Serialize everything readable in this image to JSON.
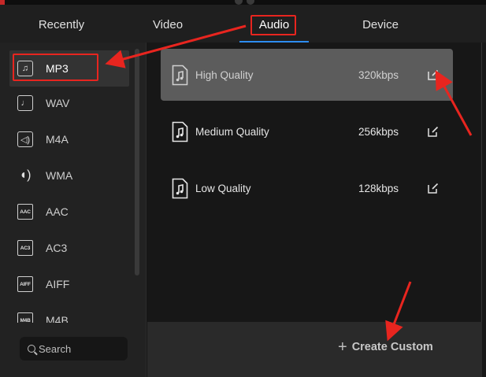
{
  "tabs": [
    {
      "label": "Recently"
    },
    {
      "label": "Video"
    },
    {
      "label": "Audio"
    },
    {
      "label": "Device"
    }
  ],
  "active_tab": "Audio",
  "formats": [
    {
      "label": "MP3",
      "icon": "music-note-icon",
      "selected": true
    },
    {
      "label": "WAV",
      "icon": "music-note-icon"
    },
    {
      "label": "M4A",
      "icon": "speaker-icon"
    },
    {
      "label": "WMA",
      "icon": "speaker-round-icon"
    },
    {
      "label": "AAC",
      "icon": "aac-file-icon",
      "tag": "AAC"
    },
    {
      "label": "AC3",
      "icon": "ac3-file-icon",
      "tag": "AC3"
    },
    {
      "label": "AIFF",
      "icon": "aiff-file-icon",
      "tag": "AIFF"
    },
    {
      "label": "M4B",
      "icon": "m4b-file-icon",
      "tag": "M4B"
    }
  ],
  "search": {
    "placeholder": "Search"
  },
  "presets": [
    {
      "name": "High Quality",
      "bitrate": "320kbps",
      "selected": true
    },
    {
      "name": "Medium Quality",
      "bitrate": "256kbps"
    },
    {
      "name": "Low Quality",
      "bitrate": "128kbps"
    }
  ],
  "create_custom": {
    "label": "Create Custom"
  },
  "colors": {
    "annotation_red": "#e8251f",
    "accent_blue": "#2d8cf0",
    "selected_preset_bg": "#5c5c5c"
  }
}
